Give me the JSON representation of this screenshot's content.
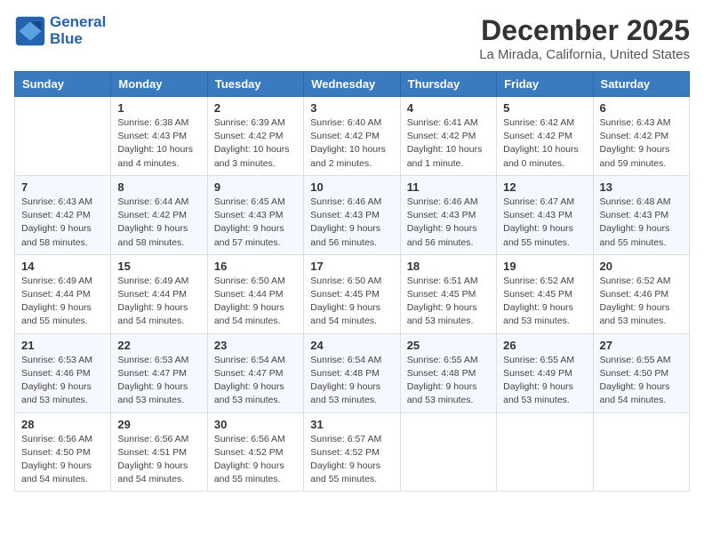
{
  "header": {
    "logo_line1": "General",
    "logo_line2": "Blue",
    "month": "December 2025",
    "location": "La Mirada, California, United States"
  },
  "days_of_week": [
    "Sunday",
    "Monday",
    "Tuesday",
    "Wednesday",
    "Thursday",
    "Friday",
    "Saturday"
  ],
  "weeks": [
    [
      {
        "day": "",
        "content": ""
      },
      {
        "day": "1",
        "content": "Sunrise: 6:38 AM\nSunset: 4:43 PM\nDaylight: 10 hours\nand 4 minutes."
      },
      {
        "day": "2",
        "content": "Sunrise: 6:39 AM\nSunset: 4:42 PM\nDaylight: 10 hours\nand 3 minutes."
      },
      {
        "day": "3",
        "content": "Sunrise: 6:40 AM\nSunset: 4:42 PM\nDaylight: 10 hours\nand 2 minutes."
      },
      {
        "day": "4",
        "content": "Sunrise: 6:41 AM\nSunset: 4:42 PM\nDaylight: 10 hours\nand 1 minute."
      },
      {
        "day": "5",
        "content": "Sunrise: 6:42 AM\nSunset: 4:42 PM\nDaylight: 10 hours\nand 0 minutes."
      },
      {
        "day": "6",
        "content": "Sunrise: 6:43 AM\nSunset: 4:42 PM\nDaylight: 9 hours\nand 59 minutes."
      }
    ],
    [
      {
        "day": "7",
        "content": "Sunrise: 6:43 AM\nSunset: 4:42 PM\nDaylight: 9 hours\nand 58 minutes."
      },
      {
        "day": "8",
        "content": "Sunrise: 6:44 AM\nSunset: 4:42 PM\nDaylight: 9 hours\nand 58 minutes."
      },
      {
        "day": "9",
        "content": "Sunrise: 6:45 AM\nSunset: 4:43 PM\nDaylight: 9 hours\nand 57 minutes."
      },
      {
        "day": "10",
        "content": "Sunrise: 6:46 AM\nSunset: 4:43 PM\nDaylight: 9 hours\nand 56 minutes."
      },
      {
        "day": "11",
        "content": "Sunrise: 6:46 AM\nSunset: 4:43 PM\nDaylight: 9 hours\nand 56 minutes."
      },
      {
        "day": "12",
        "content": "Sunrise: 6:47 AM\nSunset: 4:43 PM\nDaylight: 9 hours\nand 55 minutes."
      },
      {
        "day": "13",
        "content": "Sunrise: 6:48 AM\nSunset: 4:43 PM\nDaylight: 9 hours\nand 55 minutes."
      }
    ],
    [
      {
        "day": "14",
        "content": "Sunrise: 6:49 AM\nSunset: 4:44 PM\nDaylight: 9 hours\nand 55 minutes."
      },
      {
        "day": "15",
        "content": "Sunrise: 6:49 AM\nSunset: 4:44 PM\nDaylight: 9 hours\nand 54 minutes."
      },
      {
        "day": "16",
        "content": "Sunrise: 6:50 AM\nSunset: 4:44 PM\nDaylight: 9 hours\nand 54 minutes."
      },
      {
        "day": "17",
        "content": "Sunrise: 6:50 AM\nSunset: 4:45 PM\nDaylight: 9 hours\nand 54 minutes."
      },
      {
        "day": "18",
        "content": "Sunrise: 6:51 AM\nSunset: 4:45 PM\nDaylight: 9 hours\nand 53 minutes."
      },
      {
        "day": "19",
        "content": "Sunrise: 6:52 AM\nSunset: 4:45 PM\nDaylight: 9 hours\nand 53 minutes."
      },
      {
        "day": "20",
        "content": "Sunrise: 6:52 AM\nSunset: 4:46 PM\nDaylight: 9 hours\nand 53 minutes."
      }
    ],
    [
      {
        "day": "21",
        "content": "Sunrise: 6:53 AM\nSunset: 4:46 PM\nDaylight: 9 hours\nand 53 minutes."
      },
      {
        "day": "22",
        "content": "Sunrise: 6:53 AM\nSunset: 4:47 PM\nDaylight: 9 hours\nand 53 minutes."
      },
      {
        "day": "23",
        "content": "Sunrise: 6:54 AM\nSunset: 4:47 PM\nDaylight: 9 hours\nand 53 minutes."
      },
      {
        "day": "24",
        "content": "Sunrise: 6:54 AM\nSunset: 4:48 PM\nDaylight: 9 hours\nand 53 minutes."
      },
      {
        "day": "25",
        "content": "Sunrise: 6:55 AM\nSunset: 4:48 PM\nDaylight: 9 hours\nand 53 minutes."
      },
      {
        "day": "26",
        "content": "Sunrise: 6:55 AM\nSunset: 4:49 PM\nDaylight: 9 hours\nand 53 minutes."
      },
      {
        "day": "27",
        "content": "Sunrise: 6:55 AM\nSunset: 4:50 PM\nDaylight: 9 hours\nand 54 minutes."
      }
    ],
    [
      {
        "day": "28",
        "content": "Sunrise: 6:56 AM\nSunset: 4:50 PM\nDaylight: 9 hours\nand 54 minutes."
      },
      {
        "day": "29",
        "content": "Sunrise: 6:56 AM\nSunset: 4:51 PM\nDaylight: 9 hours\nand 54 minutes."
      },
      {
        "day": "30",
        "content": "Sunrise: 6:56 AM\nSunset: 4:52 PM\nDaylight: 9 hours\nand 55 minutes."
      },
      {
        "day": "31",
        "content": "Sunrise: 6:57 AM\nSunset: 4:52 PM\nDaylight: 9 hours\nand 55 minutes."
      },
      {
        "day": "",
        "content": ""
      },
      {
        "day": "",
        "content": ""
      },
      {
        "day": "",
        "content": ""
      }
    ]
  ]
}
